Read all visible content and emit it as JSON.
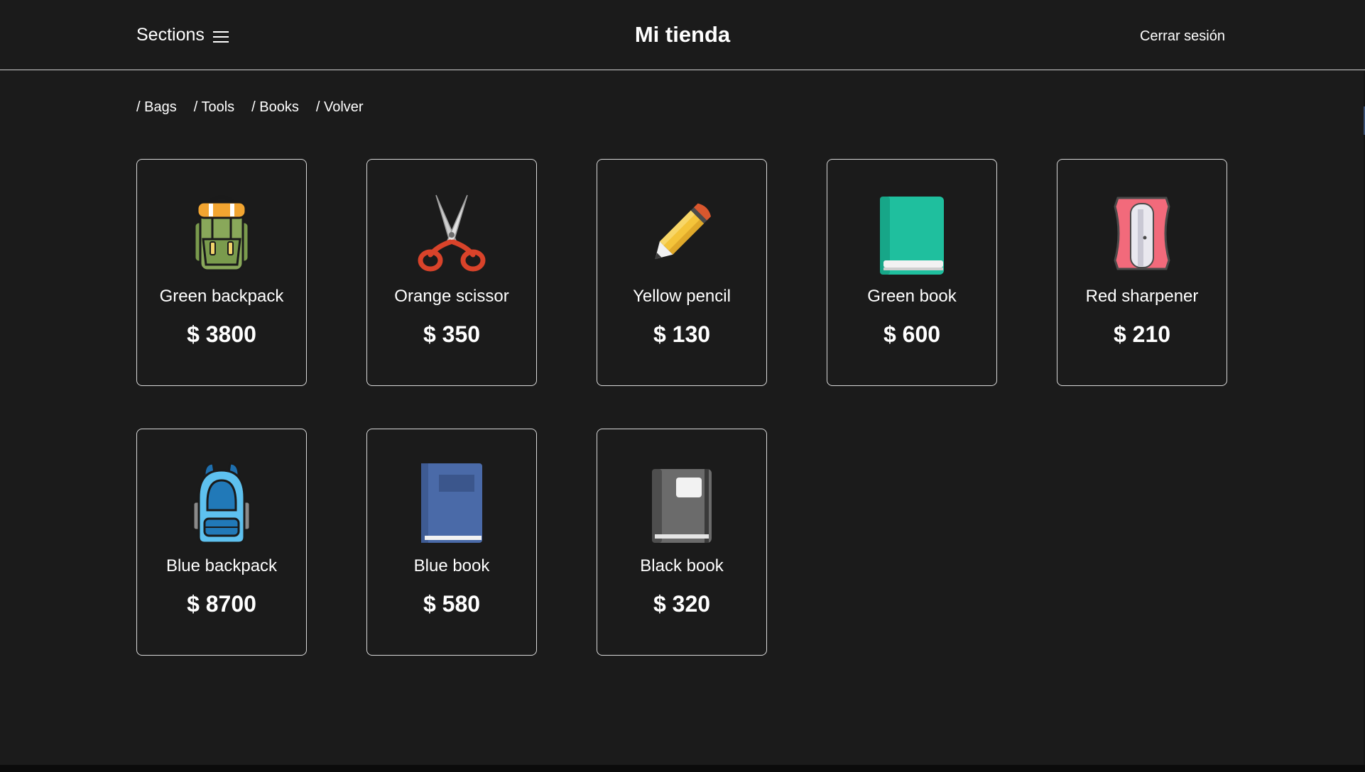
{
  "header": {
    "sections_label": "Sections",
    "site_title": "Mi tienda",
    "logout_label": "Cerrar sesión"
  },
  "category_nav": {
    "items": [
      "/ Bags",
      "/ Tools",
      "/ Books",
      "/ Volver"
    ]
  },
  "products": [
    {
      "name": "Green backpack",
      "price": "$ 3800",
      "icon": "green-backpack-icon"
    },
    {
      "name": "Orange scissor",
      "price": "$ 350",
      "icon": "scissors-icon"
    },
    {
      "name": "Yellow pencil",
      "price": "$ 130",
      "icon": "pencil-icon"
    },
    {
      "name": "Green book",
      "price": "$ 600",
      "icon": "green-book-icon"
    },
    {
      "name": "Red sharpener",
      "price": "$ 210",
      "icon": "sharpener-icon"
    },
    {
      "name": "Blue backpack",
      "price": "$ 8700",
      "icon": "blue-backpack-icon"
    },
    {
      "name": "Blue book",
      "price": "$ 580",
      "icon": "blue-book-icon"
    },
    {
      "name": "Black book",
      "price": "$ 320",
      "icon": "black-book-icon"
    }
  ],
  "colors": {
    "background": "#1b1b1b",
    "text": "#ffffff",
    "card_border": "#d9d9d9"
  }
}
